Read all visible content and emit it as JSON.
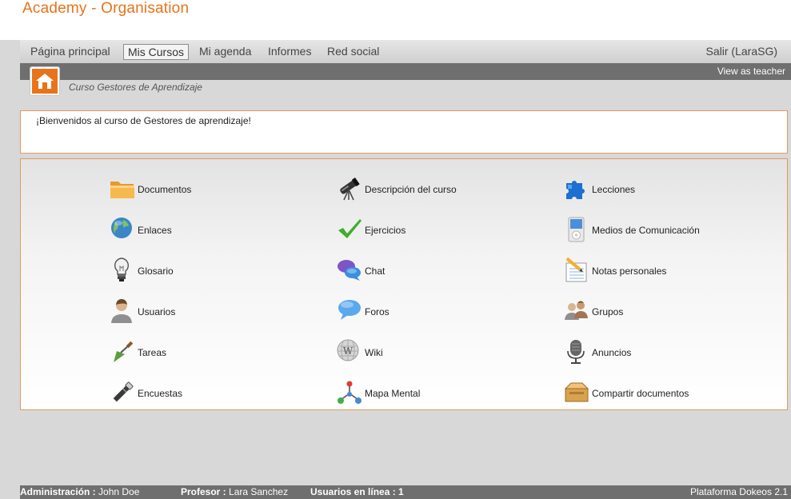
{
  "header": {
    "title": "Academy - Organisation"
  },
  "nav": {
    "items": [
      {
        "label": "Página principal"
      },
      {
        "label": "Mis Cursos"
      },
      {
        "label": "Mi agenda"
      },
      {
        "label": "Informes"
      },
      {
        "label": "Red social"
      }
    ],
    "logout": "Salir (LaraSG)"
  },
  "subbar": {
    "view_as": "View as teacher"
  },
  "breadcrumb": "Curso Gestores de Aprendizaje",
  "intro": "¡Bienvenidos al curso de Gestores de aprendizaje!",
  "tools": [
    {
      "label": "Documentos",
      "icon": "folder-icon"
    },
    {
      "label": "Descripción del curso",
      "icon": "telescope-icon"
    },
    {
      "label": "Lecciones",
      "icon": "puzzle-icon"
    },
    {
      "label": "Enlaces",
      "icon": "globe-icon"
    },
    {
      "label": "Ejercicios",
      "icon": "checkmark-icon"
    },
    {
      "label": "Medios de Comunicación",
      "icon": "media-player-icon"
    },
    {
      "label": "Glosario",
      "icon": "lightbulb-icon"
    },
    {
      "label": "Chat",
      "icon": "chat-bubbles-icon"
    },
    {
      "label": "Notas personales",
      "icon": "notepad-icon"
    },
    {
      "label": "Usuarios",
      "icon": "user-icon"
    },
    {
      "label": "Foros",
      "icon": "speech-bubble-icon"
    },
    {
      "label": "Grupos",
      "icon": "group-icon"
    },
    {
      "label": "Tareas",
      "icon": "trowel-icon"
    },
    {
      "label": "Wiki",
      "icon": "wiki-globe-icon"
    },
    {
      "label": "Anuncios",
      "icon": "microphone-icon"
    },
    {
      "label": "Encuestas",
      "icon": "flashlight-icon"
    },
    {
      "label": "Mapa Mental",
      "icon": "mind-map-icon"
    },
    {
      "label": "Compartir documentos",
      "icon": "open-box-icon"
    }
  ],
  "footer": {
    "admin_label": "Administración :",
    "admin_name": "John Doe",
    "teacher_label": "Profesor :",
    "teacher_name": "Lara Sanchez",
    "online_label": "Usuarios en línea : 1",
    "platform": "Plataforma Dokeos 2.1"
  },
  "colors": {
    "accent": "#e8731a",
    "bar": "#6f6f6f",
    "border": "#e39a5c"
  }
}
